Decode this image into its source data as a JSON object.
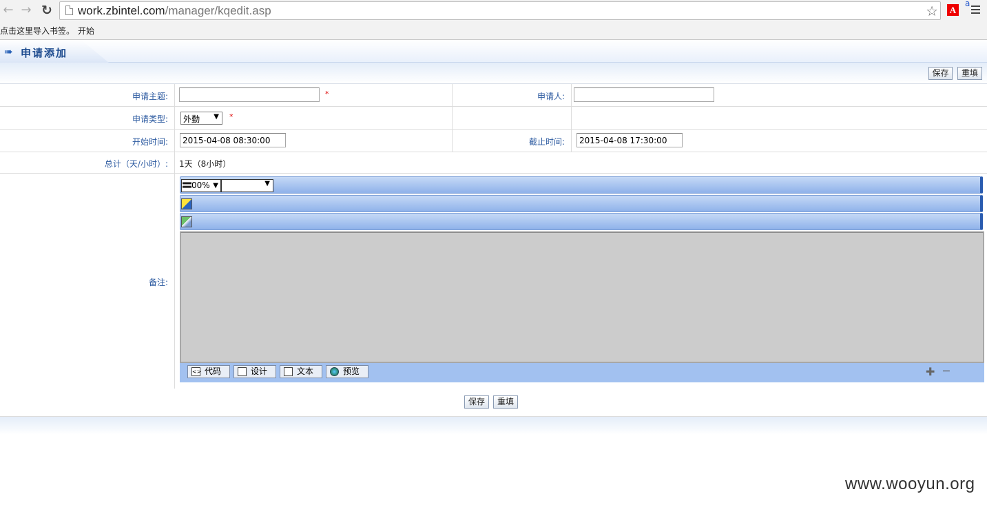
{
  "browser": {
    "url_host": "work.zbintel.com",
    "url_path": "/manager/kqedit.asp",
    "bookmarks_hint": "点击这里导入书签。",
    "bookmark_link": "开始",
    "ext_label": "A",
    "translate_label": "a"
  },
  "header": {
    "title": "申请添加"
  },
  "actions": {
    "save": "保存",
    "reset": "重填"
  },
  "form": {
    "subject_label": "申请主题:",
    "subject_value": "",
    "applicant_label": "申请人:",
    "applicant_value": "",
    "type_label": "申请类型:",
    "type_value": "外勤",
    "required_mark": "*",
    "start_label": "开始时间:",
    "start_value": "2015-04-08 08:30:00",
    "end_label": "截止时间:",
    "end_value": "2015-04-08 17:30:00",
    "total_label": "总计（天/小时）:",
    "total_value": "1天（8小时）",
    "remark_label": "备注:"
  },
  "editor": {
    "zoom_value": "00%",
    "modes": {
      "code": "代码",
      "design": "设计",
      "text": "文本",
      "preview": "预览"
    }
  },
  "watermark": "www.wooyun.org"
}
